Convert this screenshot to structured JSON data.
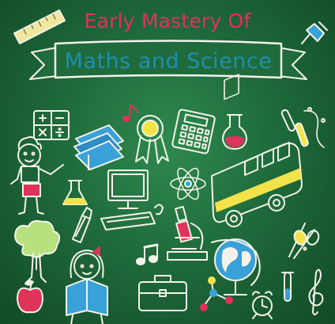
{
  "poster": {
    "title_top": "Early Mastery Of",
    "banner_text": "Maths and Science"
  },
  "colors": {
    "board": "#1f6b3b",
    "chalk": "#f3f3ea",
    "title_pink": "#e0335a",
    "banner_blue": "#1f8fb0",
    "accent_yellow": "#f2e34a",
    "accent_blue": "#3aa0d8"
  },
  "icons": [
    "ruler-icon",
    "pushpin-icon",
    "math-symbols-icon",
    "books-icon",
    "music-note-icon",
    "award-ribbon-icon",
    "calculator-icon",
    "flask-icon",
    "test-tubes-icon",
    "boy-icon",
    "erlenmeyer-flask-icon",
    "computer-icon",
    "atom-icon",
    "bus-icon",
    "pen-nib-icon",
    "microscope-icon",
    "scissors-icon",
    "tree-icon",
    "girl-reading-icon",
    "music-notes-icon",
    "globe-icon",
    "briefcase-icon",
    "molecule-icon",
    "alarm-clock-icon",
    "test-tube-icon",
    "treble-clef-icon",
    "apple-icon"
  ]
}
